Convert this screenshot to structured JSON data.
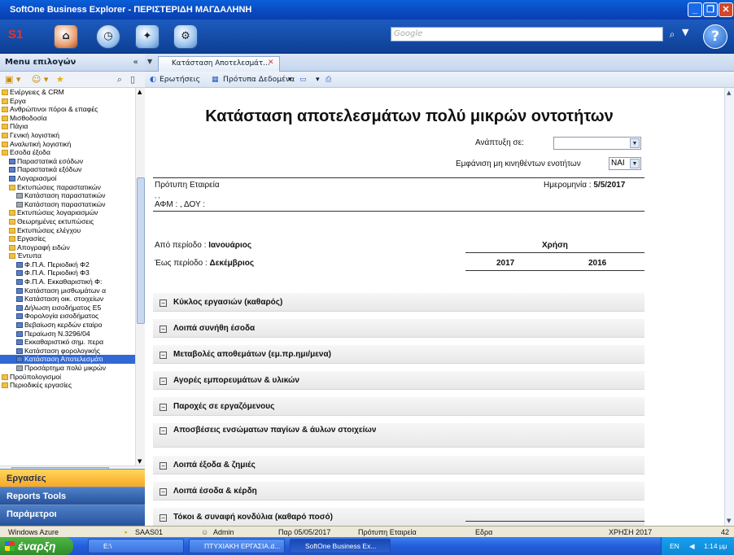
{
  "window": {
    "title": "SoftOne Business Explorer - ΠΕΡΙΣΤΕΡΙΔΗ ΜΑΓΔΑΛΗΝΗ"
  },
  "toolbar": {
    "logo": "S1",
    "search_placeholder": "Google"
  },
  "left": {
    "menu_title": "Menu επιλογών",
    "tree": [
      {
        "label": "Ενέργειες & CRM",
        "indent": 0,
        "icon": "folder"
      },
      {
        "label": "Εργα",
        "indent": 0,
        "icon": "folder"
      },
      {
        "label": "Ανθρώπινοι πόροι & επαφές",
        "indent": 0,
        "icon": "folder"
      },
      {
        "label": "Μισθοδοσία",
        "indent": 0,
        "icon": "folder"
      },
      {
        "label": "Πάγια",
        "indent": 0,
        "icon": "folder"
      },
      {
        "label": "Γενική λογιστική",
        "indent": 0,
        "icon": "folder"
      },
      {
        "label": "Αναλυτική λογιστική",
        "indent": 0,
        "icon": "folder"
      },
      {
        "label": "Εσοδα έξοδα",
        "indent": 0,
        "icon": "folder"
      },
      {
        "label": "Παραστατικά εσόδων",
        "indent": 1,
        "icon": "doc"
      },
      {
        "label": "Παραστατικά εξόδων",
        "indent": 1,
        "icon": "doc"
      },
      {
        "label": "Λογαριασμοί",
        "indent": 1,
        "icon": "doc"
      },
      {
        "label": "Εκτυπώσεις παραστατικών",
        "indent": 1,
        "icon": "folder"
      },
      {
        "label": "Κατάσταση παραστατικών",
        "indent": 2,
        "icon": "print"
      },
      {
        "label": "Κατάσταση παραστατικών",
        "indent": 2,
        "icon": "print"
      },
      {
        "label": "Εκτυπώσεις λογαριασμών",
        "indent": 1,
        "icon": "folder"
      },
      {
        "label": "Θεωρημένες εκτυπώσεις",
        "indent": 1,
        "icon": "folder"
      },
      {
        "label": "Εκτυπώσεις ελέγχου",
        "indent": 1,
        "icon": "folder"
      },
      {
        "label": "Εργασίες",
        "indent": 1,
        "icon": "folder"
      },
      {
        "label": "Απογραφή ειδών",
        "indent": 1,
        "icon": "folder"
      },
      {
        "label": "Έντυπα",
        "indent": 1,
        "icon": "folder"
      },
      {
        "label": "Φ.Π.Α. Περιοδική Φ2",
        "indent": 2,
        "icon": "doc"
      },
      {
        "label": "Φ.Π.Α. Περιοδική Φ3",
        "indent": 2,
        "icon": "doc"
      },
      {
        "label": "Φ.Π.Α. Εκκαθαριστική Φ:",
        "indent": 2,
        "icon": "doc"
      },
      {
        "label": "Κατάσταση μισθωμάτων α",
        "indent": 2,
        "icon": "doc"
      },
      {
        "label": "Κατάσταση οικ. στοιχείων",
        "indent": 2,
        "icon": "doc"
      },
      {
        "label": "Δήλωση εισοδήματος Ε5",
        "indent": 2,
        "icon": "doc"
      },
      {
        "label": "Φορολογία εισοδήματος",
        "indent": 2,
        "icon": "doc"
      },
      {
        "label": "Βεβαίωση κερδών εταίρο",
        "indent": 2,
        "icon": "doc"
      },
      {
        "label": "Περαίωση Ν.3296/04",
        "indent": 2,
        "icon": "doc"
      },
      {
        "label": "Εκκαθαριστικό σημ. περα",
        "indent": 2,
        "icon": "doc"
      },
      {
        "label": "Κατάσταση φορολογικής",
        "indent": 2,
        "icon": "doc"
      },
      {
        "label": "Κατάσταση Αποτελεσμάτι",
        "indent": 2,
        "icon": "doc",
        "selected": true
      },
      {
        "label": "Προσάρτημα πολύ μικρών",
        "indent": 2,
        "icon": "print"
      },
      {
        "label": "Προϋπολογισμοί",
        "indent": 0,
        "icon": "folder"
      },
      {
        "label": "Περιοδικές εργασίες",
        "indent": 0,
        "icon": "folder"
      }
    ],
    "nav": {
      "ergasies": "Εργασίες",
      "reports": "Reports Tools",
      "params": "Παράμετροι"
    }
  },
  "tab": {
    "label": "Κατάσταση Αποτελεσμάτ..."
  },
  "subtoolbar": {
    "queries": "Ερωτήσεις",
    "templates": "Πρότυπα Δεδομένα"
  },
  "report": {
    "title": "Κατάσταση αποτελεσμάτων πολύ μικρών οντοτήτων",
    "analysis_label": "Ανάπτυξη σε:",
    "analysis_value": "",
    "show_inactive_label": "Εμφάνιση μη κινηθέντων ενοτήτων",
    "show_inactive_value": "ΝΑΙ",
    "company": "Πρότυπη Εταιρεία",
    "date_label": "Ημερομηνία : ",
    "date_value": "5/5/2017",
    "commas": ", ,",
    "afm_line": "ΑΦΜ : , ΔΟΥ :",
    "from_label": "Από περίοδο : ",
    "from_value": "Ιανουάριος",
    "to_label": "Έως περίοδο : ",
    "to_value": "Δεκέμβριος",
    "usage_label": "Χρήση",
    "year1": "2017",
    "year2": "2016",
    "sections": [
      {
        "label": "Κύκλος εργασιών (καθαρός)"
      },
      {
        "label": "Λοιπά συνήθη έσοδα"
      },
      {
        "label": "Μεταβολές αποθεμάτων (εμ.πρ.ημι/μενα)"
      },
      {
        "label": "Αγορές εμπορευμάτων & υλικών"
      },
      {
        "label": "Παροχές σε εργαζόμενους"
      },
      {
        "label": "Αποσβέσεις ενσώματων παγίων & άυλων στοιχείων"
      },
      {
        "label": "Λοιπά έξοδα & ζημιές"
      },
      {
        "label": "Λοιπά έσοδα & κέρδη"
      },
      {
        "label": "Τόκοι & συναφή κονδύλια (καθαρό ποσό)"
      }
    ]
  },
  "status": {
    "s1": "Windows Azure",
    "s2": "SAAS01",
    "s3": "Admin",
    "s4": "Παρ 05/05/2017",
    "s5": "Πρότυπη Εταιρεία",
    "s6": "Εδρα",
    "s7": "ΧΡΗΣΗ 2017",
    "s8": "42"
  },
  "taskbar": {
    "start": "έναρξη",
    "t1": "E:\\",
    "t2": "ΠΤΥΧΙΑΚΗ ΕΡΓΑΣΙΑ.d...",
    "t3": "SoftOne Business Ex...",
    "lang": "EN",
    "time": "1:14 μμ"
  }
}
